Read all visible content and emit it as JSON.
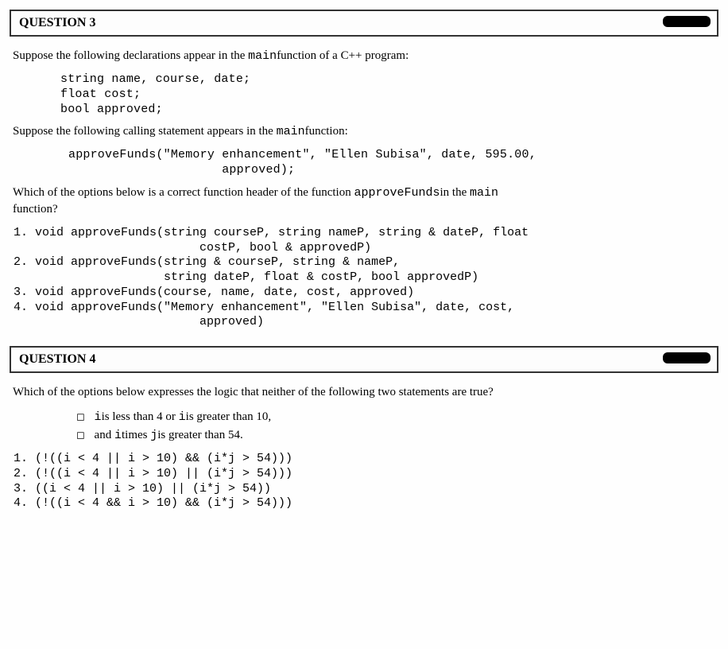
{
  "q3": {
    "header": "QUESTION 3",
    "p1_a": "Suppose the following declarations appear in the ",
    "p1_code": "main",
    "p1_b": "function of a C++ program:",
    "decl": "string name, course, date;\nfloat cost;\nbool approved;",
    "p2_a": "Suppose the following calling statement appears in the ",
    "p2_code": "main",
    "p2_b": "function:",
    "call": "approveFunds(\"Memory enhancement\", \"Ellen Subisa\", date, 595.00,\n                     approved);",
    "p3_a": "Which of the options below is a correct function header of the function ",
    "p3_code": "approveFunds",
    "p3_b": "in the ",
    "p3_code2": "main",
    "p3_c": " function?",
    "options": [
      "void approveFunds(string courseP, string nameP, string & dateP, float\n                       costP, bool & approvedP)",
      "void approveFunds(string & courseP, string & nameP,\n                  string dateP, float & costP, bool approvedP)",
      "void approveFunds(course, name, date, cost, approved)",
      "void approveFunds(\"Memory enhancement\", \"Ellen Subisa\", date, cost,\n                       approved)"
    ]
  },
  "q4": {
    "header": "QUESTION 4",
    "p1": "Which of the options below expresses the logic that neither of the following two statements are true?",
    "s1_a": "i",
    "s1_b": "is less than 4 or ",
    "s1_c": "i",
    "s1_d": "is greater than 10,",
    "s2_a": "and ",
    "s2_b": "i",
    "s2_c": "times ",
    "s2_d": "j",
    "s2_e": "is greater than 54.",
    "options": [
      "(!((i < 4 || i > 10) && (i*j > 54)))",
      "(!((i < 4 || i > 10) || (i*j > 54)))",
      "((i < 4 || i > 10) || (i*j > 54))",
      "(!((i < 4 && i > 10) && (i*j > 54)))"
    ]
  }
}
